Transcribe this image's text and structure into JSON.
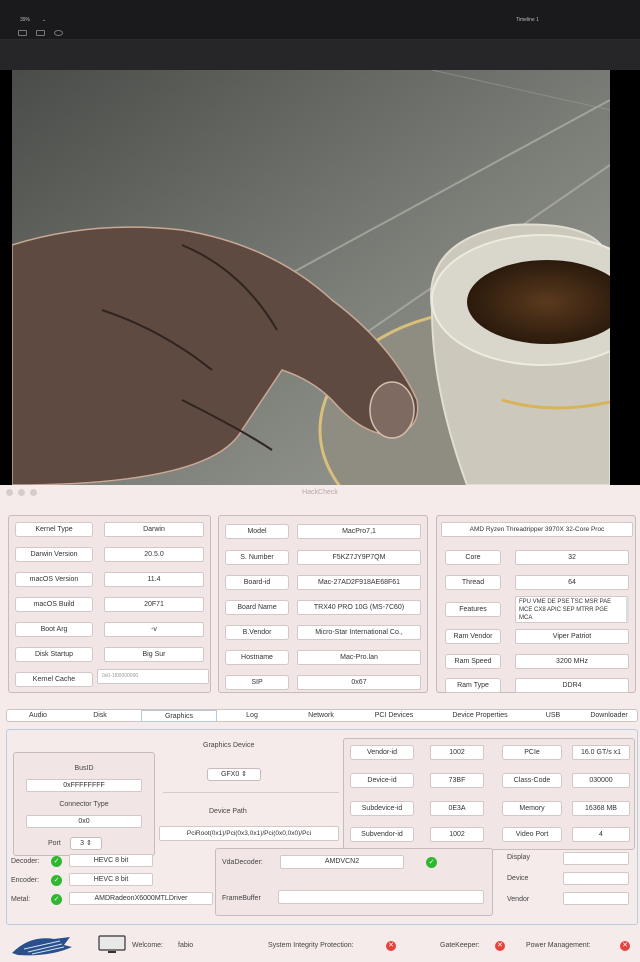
{
  "video": {
    "zoom": "39%",
    "timeline": "Timeline 1",
    "arrow": "⌄"
  },
  "window": {
    "title": "HackCheck"
  },
  "system": [
    {
      "label": "Kernel Type",
      "value": "Darwin"
    },
    {
      "label": "Darwin Version",
      "value": "20.5.0"
    },
    {
      "label": "macOS Version",
      "value": "11.4"
    },
    {
      "label": "macOS Build",
      "value": "20F71"
    },
    {
      "label": "Boot Arg",
      "value": "-v"
    },
    {
      "label": "Disk Startup",
      "value": "Big Sur"
    },
    {
      "label": "Kernel Cache",
      "value": "0x0-1f00000000"
    }
  ],
  "model": [
    {
      "label": "Model",
      "value": "MacPro7,1"
    },
    {
      "label": "S. Number",
      "value": "F5KZ7JY9P7QM"
    },
    {
      "label": "Board-id",
      "value": "Mac-27AD2F918AE68F61"
    },
    {
      "label": "Board Name",
      "value": "TRX40 PRO 10G (MS-7C60)"
    },
    {
      "label": "B.Vendor",
      "value": "Micro-Star International Co.,"
    },
    {
      "label": "Hostname",
      "value": "Mac-Pro.lan"
    },
    {
      "label": "SIP",
      "value": "0x67"
    }
  ],
  "cpu": {
    "name": "AMD Ryzen Threadripper 3970X 32-Core Proc",
    "rows": [
      {
        "label": "Core",
        "value": "32"
      },
      {
        "label": "Thread",
        "value": "64"
      },
      {
        "label": "Features",
        "value": "FPU VME DE PSE TSC MSR PAE MCE CX8 APIC SEP MTRR PGE MCA"
      },
      {
        "label": "Ram Vendor",
        "value": "Viper Patriot"
      },
      {
        "label": "Ram Speed",
        "value": "3200 MHz"
      },
      {
        "label": "Ram Type",
        "value": "DDR4"
      }
    ]
  },
  "tabs": [
    "Audio",
    "Disk",
    "Graphics",
    "Log",
    "Network",
    "PCI Devices",
    "Device Properties",
    "USB",
    "Downloader"
  ],
  "selected_tab": "Graphics",
  "graphics": {
    "busid_label": "BusID",
    "busid_value": "0xFFFFFFFF",
    "connector_label": "Connector Type",
    "connector_value": "0x0",
    "port_label": "Port",
    "port_value": "3 ⇕",
    "device_title": "Graphics Device",
    "device_select": "GFX0 ⇕",
    "path_label": "Device Path",
    "path_value": "PciRoot(0x1)/Pci(0x3,0x1)/Pci(0x0,0x0)/Pci",
    "ids": [
      {
        "label": "Vendor-id",
        "value": "1002"
      },
      {
        "label": "Device-id",
        "value": "73BF"
      },
      {
        "label": "Subdevice-id",
        "value": "0E3A"
      },
      {
        "label": "Subvendor-id",
        "value": "1002"
      }
    ],
    "right": [
      {
        "label": "PCIe",
        "value": "16.0 GT/s x1"
      },
      {
        "label": "Class-Code",
        "value": "030000"
      },
      {
        "label": "Memory",
        "value": "16368 MB"
      },
      {
        "label": "Video Port",
        "value": "4"
      }
    ],
    "decoder_label": "Decoder:",
    "decoder_value": "HEVC 8 bit",
    "encoder_label": "Encoder:",
    "encoder_value": "HEVC 8 bit",
    "metal_label": "Metal:",
    "metal_value": "AMDRadeonX6000MTLDriver",
    "vda_label": "VdaDecoder:",
    "vda_value": "AMDVCN2",
    "fb_label": "FrameBuffer",
    "fb_value": "",
    "display_label": "Display",
    "device_label": "Device",
    "vendor_label": "Vendor"
  },
  "status": {
    "welcome_label": "Welcome:",
    "user": "fabio",
    "sip": "System Integrity Protection:",
    "gatekeeper": "GateKeeper:",
    "power": "Power Management:"
  }
}
